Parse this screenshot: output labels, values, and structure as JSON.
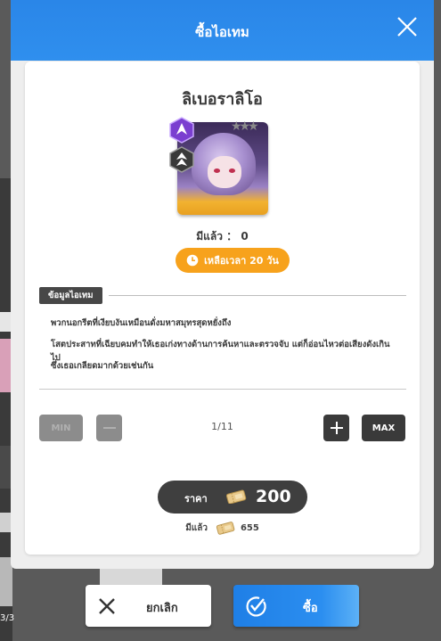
{
  "modal": {
    "title": "ซื้อไอเทม"
  },
  "item": {
    "name": "ลิเบอราลิโอ",
    "rarity_stars": "★★★"
  },
  "owned": {
    "text": "มีแล้ว ： 0"
  },
  "timer": {
    "text": "เหลือเวลา 20 วัน",
    "icon": "clock-icon"
  },
  "info": {
    "tag": "ข้อมูลไอเทม",
    "line1": "พวกนอกรีตที่เงียบงันเหมือนดั่งมหาสมุทรสุดหยั่งถึง",
    "line2": "โสตประสาทที่เฉียบคมทำให้เธอเก่งทางด้านการค้นหาและตรวจจับ  แต่ก็อ่อนไหวต่อเสียงดังเกินไป",
    "line3": "ซึ่งเธอเกลียดมากด้วยเช่นกัน"
  },
  "quantity": {
    "min_label": "MIN",
    "max_label": "MAX",
    "value": "1/11"
  },
  "price": {
    "label": "ราคา",
    "value": "200",
    "owned_label": "มีแล้ว",
    "owned_value": "655"
  },
  "buttons": {
    "cancel": "ยกเลิก",
    "confirm": "ซื้อ"
  },
  "background": {
    "counter": "3/3"
  },
  "colors": {
    "header": "#2f8fee",
    "timer": "#f7a21c",
    "confirm": "#1f7fe6"
  }
}
